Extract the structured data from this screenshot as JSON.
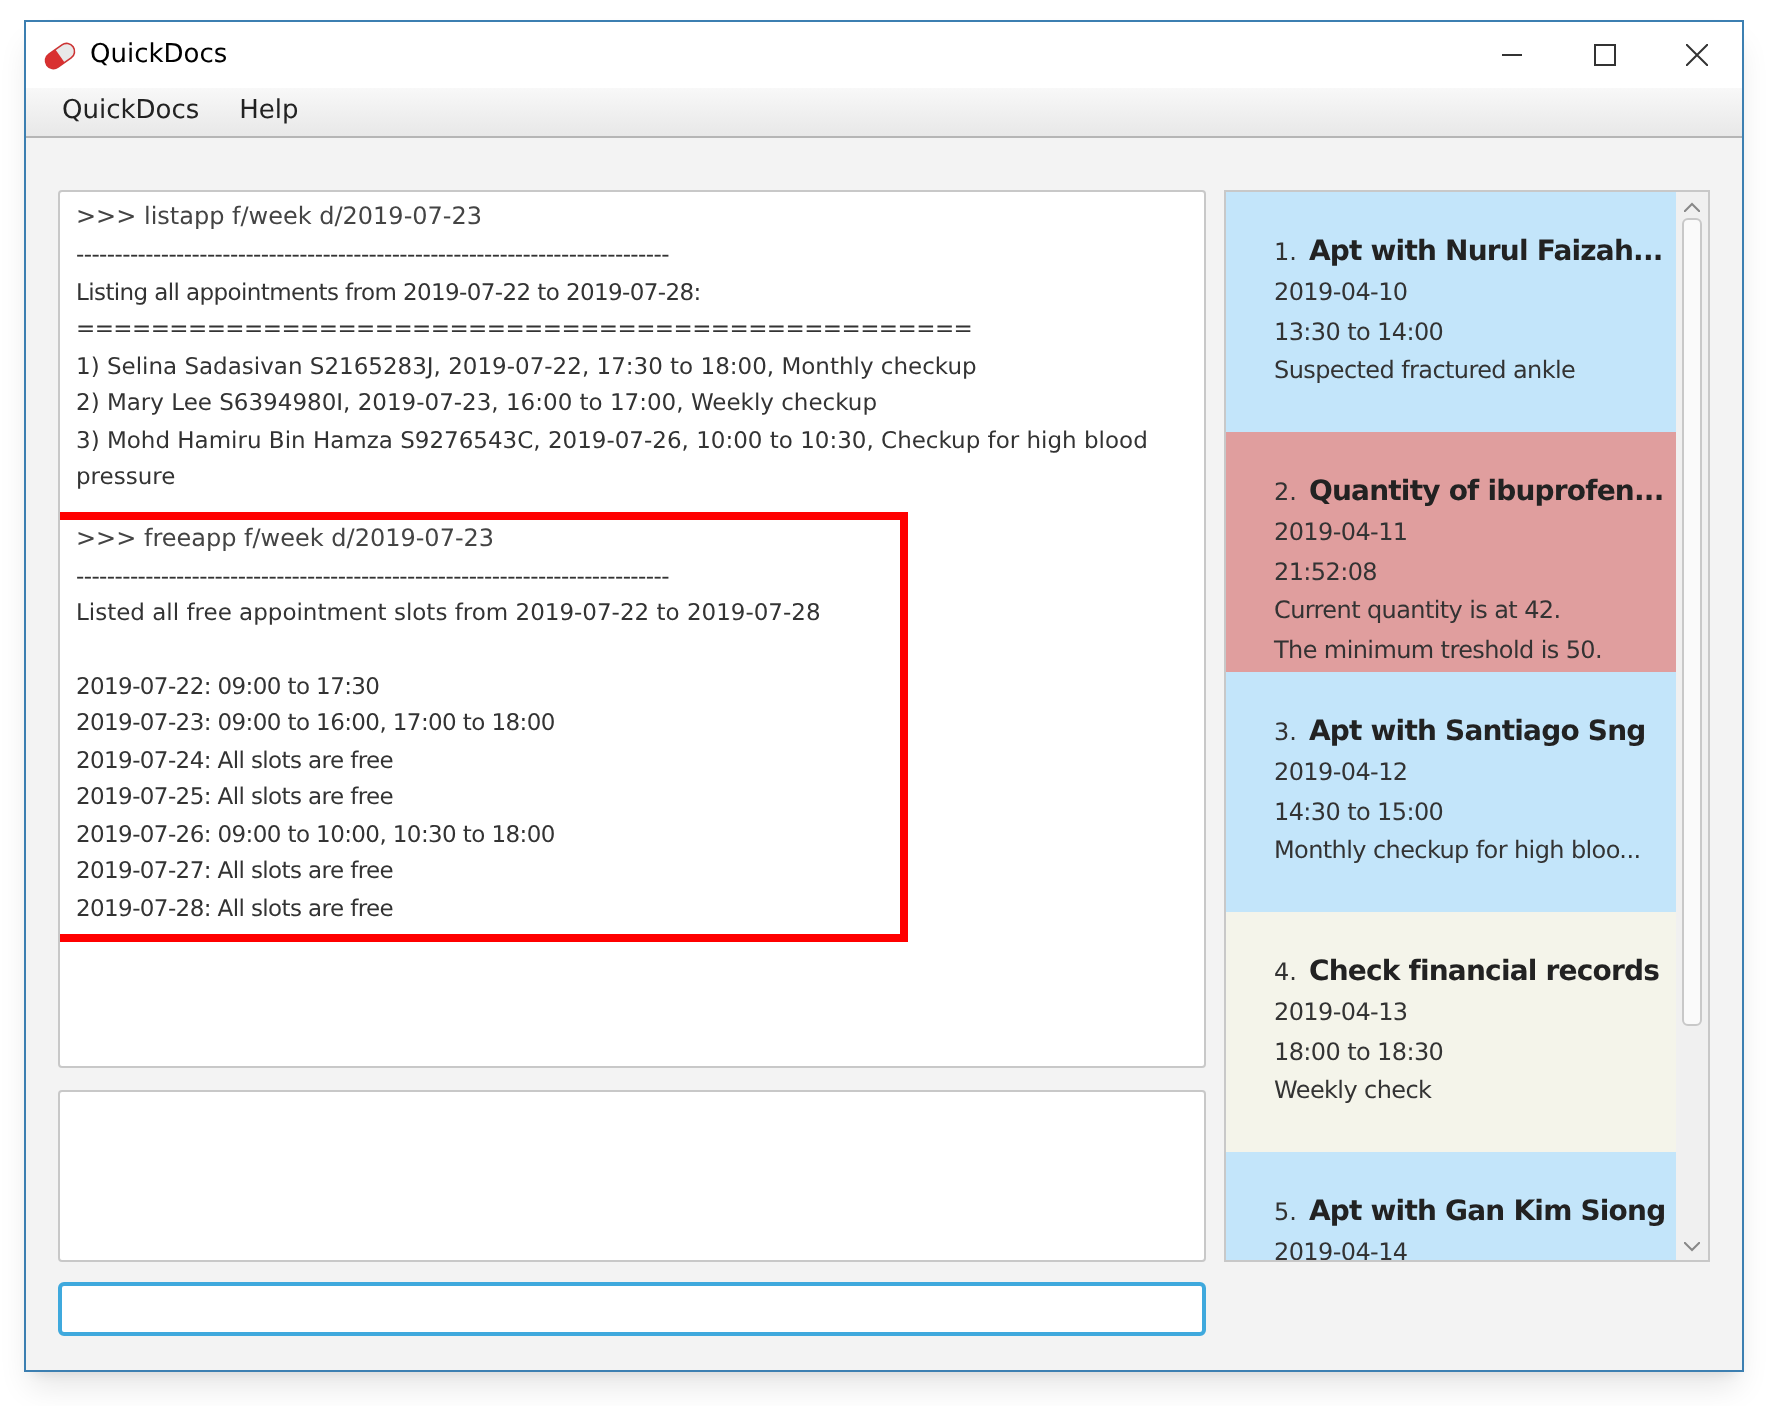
{
  "window": {
    "title": "QuickDocs"
  },
  "menu": [
    {
      "label": "QuickDocs"
    },
    {
      "label": "Help"
    }
  ],
  "output": [
    {
      "command": ">>> listapp f/week d/2019-07-23",
      "highlighted": false,
      "sections": [
        [
          "-----------------------------------------------------------------------------",
          "Listing all appointments from 2019-07-22 to 2019-07-28:",
          "================================================",
          "1) Selina Sadasivan S2165283J, 2019-07-22, 17:30 to 18:00, Monthly checkup",
          "2) Mary Lee S6394980I, 2019-07-23, 16:00 to 17:00, Weekly checkup",
          "3) Mohd Hamiru Bin Hamza S9276543C, 2019-07-26, 10:00 to 10:30, Checkup for high blood pressure"
        ]
      ]
    },
    {
      "command": ">>> freeapp f/week d/2019-07-23",
      "highlighted": true,
      "sections": [
        [
          "-----------------------------------------------------------------------------",
          "Listed all free appointment slots from 2019-07-22 to 2019-07-28"
        ],
        [
          "2019-07-22: 09:00 to 17:30",
          "2019-07-23: 09:00 to 16:00, 17:00 to 18:00",
          "2019-07-24: All slots are free",
          "2019-07-25: All slots are free",
          "2019-07-26: 09:00 to 10:00, 10:30 to 18:00",
          "2019-07-27: All slots are free",
          "2019-07-28: All slots are free"
        ]
      ]
    }
  ],
  "cards": [
    {
      "number": "1.",
      "title": "Apt with Nurul Faizah...",
      "color": "#c3e5fa",
      "lines": [
        "2019-04-10",
        "13:30 to 14:00",
        "Suspected fractured ankle"
      ]
    },
    {
      "number": "2.",
      "title": "Quantity of ibuprofen...",
      "color": "#e09e9e",
      "lines": [
        "2019-04-11",
        "21:52:08",
        "Current quantity is at 42.",
        "The minimum treshold is 50."
      ]
    },
    {
      "number": "3.",
      "title": "Apt with Santiago Sng",
      "color": "#c3e5fa",
      "lines": [
        "2019-04-12",
        "14:30 to 15:00",
        "Monthly checkup for high bloo..."
      ]
    },
    {
      "number": "4.",
      "title": "Check financial records",
      "color": "#f4f4ea",
      "lines": [
        "2019-04-13",
        "18:00 to 18:30",
        "Weekly check"
      ]
    },
    {
      "number": "5.",
      "title": "Apt with Gan Kim Siong",
      "color": "#c3e5fa",
      "lines": [
        "2019-04-14"
      ]
    }
  ]
}
